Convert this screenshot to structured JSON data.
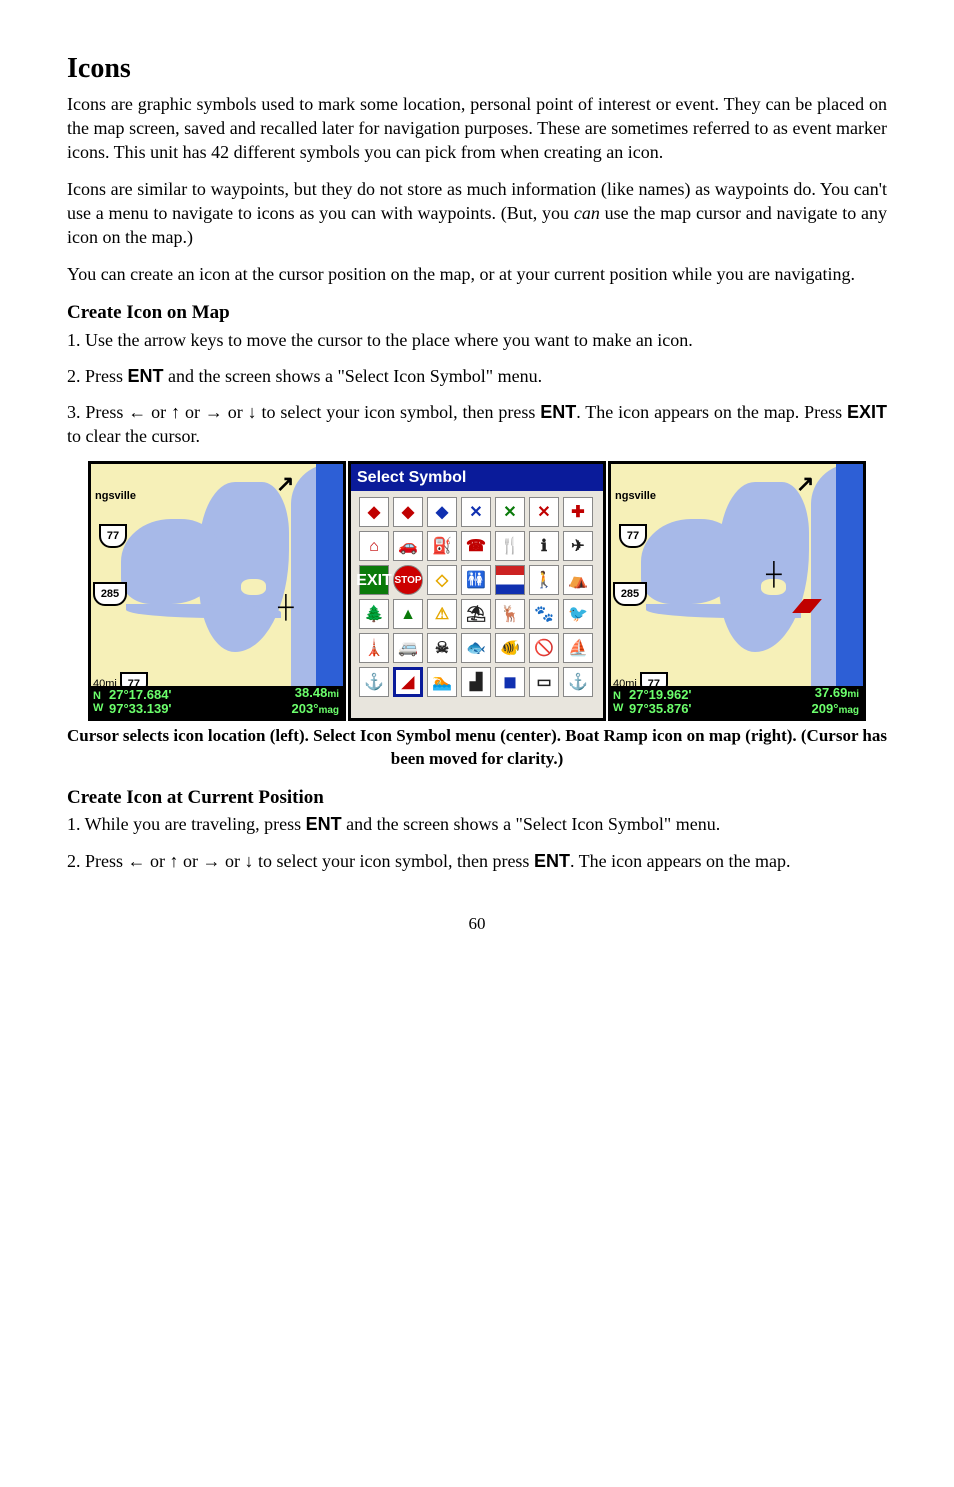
{
  "heading": "Icons",
  "para1": "Icons are graphic symbols used to mark some location, personal point of interest or event. They can be placed on the map screen, saved and recalled later for navigation purposes. These are sometimes referred to as event marker icons. This unit has 42 different symbols you can pick from when creating an icon.",
  "para2a": "Icons are similar to waypoints, but they do not store as much information (like names) as waypoints do. You can't use a menu to navigate to icons as you can with waypoints. (But, you ",
  "para2b": "can",
  "para2c": " use the map cursor and navigate to any icon on the map.)",
  "para3": "You can create an icon at the cursor position on the map, or at your current position while you are navigating.",
  "sub1": "Create Icon on Map",
  "step1_1": "1. Use the arrow keys to move the cursor to the place where you want to make an icon.",
  "step1_2a": "2. Press ",
  "step1_2b": "ENT",
  "step1_2c": " and the screen shows a \"Select Icon Symbol\" menu.",
  "step1_3a": "3. Press ← or ↑ or → or ↓ to select your icon symbol, then press ",
  "step1_3b": "ENT",
  "step1_3c": ". The icon appears on the map. Press ",
  "step1_3d": "EXIT",
  "step1_3e": " to clear the cursor.",
  "caption1": "Cursor selects icon location (left). Select Icon Symbol menu (center). Boat Ramp icon on map (right). (Cursor has been moved for clarity.)",
  "sub2": "Create Icon at Current Position",
  "step2_1a": "1. While you are traveling, press ",
  "step2_1b": "ENT",
  "step2_1c": " and the screen shows a \"Select Icon Symbol\" menu.",
  "step2_2a": "2. Press ← or ↑ or → or ↓ to select your icon symbol, then press ",
  "step2_2b": "ENT",
  "step2_2c": ". The icon appears on the map.",
  "page_num": "60",
  "map_left": {
    "place": "ngsville",
    "shield1": "77",
    "shield2": "285",
    "shield3": "77",
    "dist": "40mi",
    "lat": "27°17.684'",
    "lon": "97°33.139'",
    "dist_val": "38.48",
    "dist_unit": "mi",
    "brg_val": "203°",
    "brg_unit": "mag"
  },
  "symbol_title": "Select Symbol",
  "map_right": {
    "place": "ngsville",
    "shield1": "77",
    "shield2": "285",
    "shield3": "77",
    "dist": "40mi",
    "lat": "27°19.962'",
    "lon": "97°35.876'",
    "dist_val": "37.69",
    "dist_unit": "mi",
    "brg_val": "209°",
    "brg_unit": "mag"
  }
}
